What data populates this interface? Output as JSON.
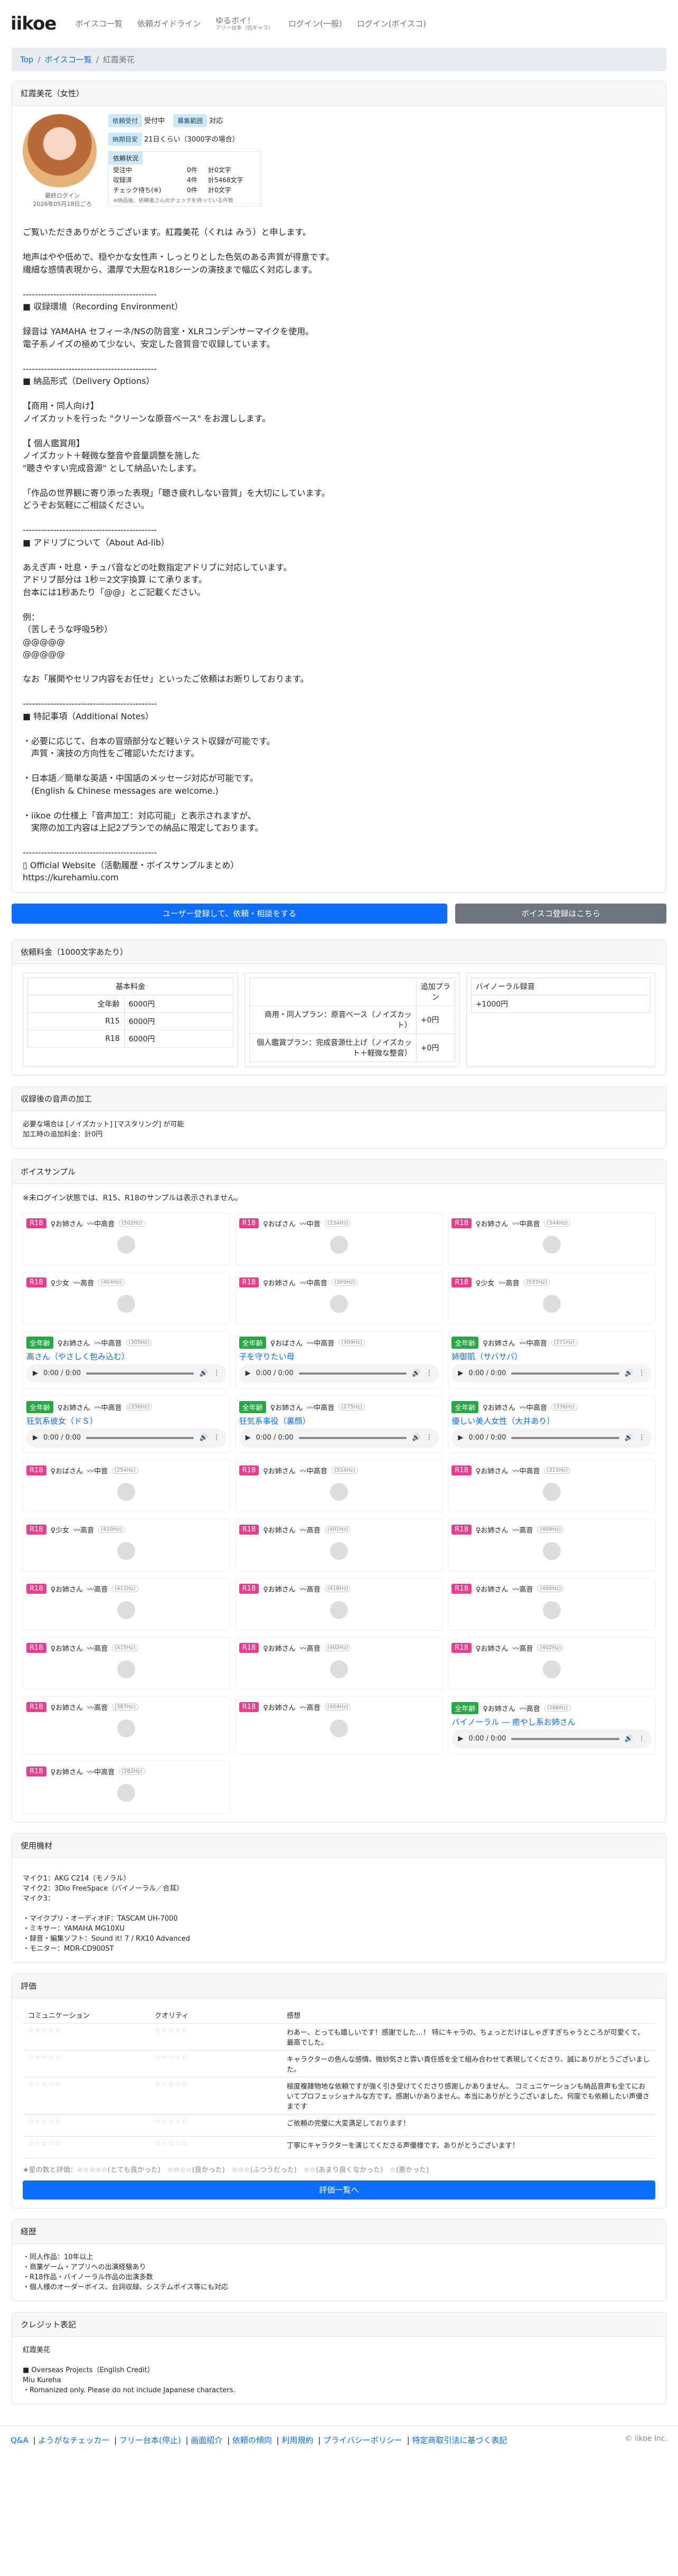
{
  "nav": {
    "brand": "iikoe",
    "links": [
      "ボイスコ一覧",
      "依頼ガイドライン",
      "ゆるボイ！",
      "ログイン(一般)",
      "ログイン(ボイスコ)"
    ],
    "yurusub": "フリー台本（低ギャラ）"
  },
  "breadcrumb": {
    "top": "Top",
    "list": "ボイスコ一覧",
    "current": "紅霞美花"
  },
  "profile": {
    "header": "紅霞美花（女性）",
    "last_login_label": "最終ログイン",
    "last_login": "2026年05月18日ごろ",
    "badges": [
      {
        "label": "依頼受付",
        "value": "受付中"
      },
      {
        "label": "募集範囲",
        "value": "対応"
      },
      {
        "label": "納期目安",
        "value": "21日くらい（3000字の場合）"
      }
    ],
    "counts_title": "依頼状況",
    "counts": [
      {
        "k": "受注中",
        "n": "0件",
        "v": "計0文字"
      },
      {
        "k": "収録済",
        "n": "4件",
        "v": "計5468文字"
      },
      {
        "k": "チェック待ち(※)",
        "n": "0件",
        "v": "計0文字"
      }
    ],
    "counts_note": "※納品後、依頼者さんのチェックを待っている件数",
    "description": "ご覧いただきありがとうございます。紅霞美花（くれは みう）と申します。\n\n地声はやや低めで、穏やかな女性声・しっとりとした色気のある声質が得意です。\n繊細な感情表現から、濃厚で大胆なR18シーンの演技まで幅広く対応します。\n\n--------------------------------------------\n■ 収録環境（Recording Environment）\n\n録音は YAMAHA セフィーネ/NSの防音室・XLRコンデンサーマイクを使用。\n電子系ノイズの極めて少ない、安定した音質音で収録しています。\n\n--------------------------------------------\n■ 納品形式（Delivery Options）\n\n【商用・同人向け】\nノイズカットを行った \"クリーンな原音ベース\" をお渡しします。\n\n【 個人鑑賞用】\nノイズカット＋軽微な整音や音量調整を施した\n\"聴きやすい完成音源\" として納品いたします。\n\n「作品の世界観に寄り添った表現」「聴き疲れしない音質」を大切にしています。\nどうぞお気軽にご相談ください。\n\n--------------------------------------------\n■ アドリブについて（About Ad-lib）\n\nあえぎ声・吐息・チュパ音などの吐数指定アドリブに対応しています。\nアドリブ部分は 1秒＝2文字換算 にて承ります。\n台本には1秒あたり「@@」とご記載ください。\n\n例：\n（苦しそうな呼吸5秒）\n@@@@@\n@@@@@\n\nなお「展開やセリフ内容をお任せ」といったご依頼はお断りしております。\n\n--------------------------------------------\n■ 特記事項（Additional Notes）\n\n・必要に応じて、台本の冒頭部分など軽いテスト収録が可能です。\n　声質・演技の方向性をご確認いただけます。\n\n・日本語／簡単な英語・中国語のメッセージ対応が可能です。\n　(English & Chinese messages are welcome.)\n\n・iikoe の仕様上「音声加工：対応可能」と表示されますが、\n　実際の加工内容は上記2プランでの納品に限定しております。\n\n--------------------------------------------\n▯ Official Website（活動履歴・ボイスサンプルまとめ）\nhttps://kurehamiu.com"
  },
  "buttons": {
    "request": "ユーザー登録して、依頼・相談をする",
    "register": "ボイスコ登録はこちら"
  },
  "pricing": {
    "header": "依頼料金（1000文字あたり）",
    "base_title": "基本料金",
    "base": [
      {
        "k": "全年齢",
        "v": "6000円"
      },
      {
        "k": "R15",
        "v": "6000円"
      },
      {
        "k": "R18",
        "v": "6000円"
      }
    ],
    "plan_title": "追加プラン",
    "plans": [
      {
        "k": "商用・同人プラン：原音ベース（ノイズカット）",
        "v": "+0円"
      },
      {
        "k": "個人鑑賞プラン：完成音源仕上げ（ノイズカット＋軽微な整音）",
        "v": "+0円"
      }
    ],
    "binaural_title": "バイノーラル録音",
    "binaural": "+1000円"
  },
  "processing": {
    "header": "収録後の音声の加工",
    "lines": [
      "必要な場合は [ノイズカット] [マスタリング] が可能",
      "加工時の追加料金：計0円"
    ]
  },
  "samples": {
    "header": "ボイスサンプル",
    "note": "※未ログイン状態では、R15、R18のサンプルは表示されません。",
    "items": [
      {
        "rating": "R18",
        "age": "お姉さん",
        "pitch": "中高音",
        "hz": "(502Hz)"
      },
      {
        "rating": "R18",
        "age": "おばさん",
        "pitch": "中音",
        "hz": "(234Hz)"
      },
      {
        "rating": "R18",
        "age": "お姉さん",
        "pitch": "中高音",
        "hz": "(344Hz)"
      },
      {
        "rating": "R18",
        "age": "少女",
        "pitch": "高音",
        "hz": "(404Hz)"
      },
      {
        "rating": "R18",
        "age": "お姉さん",
        "pitch": "中高音",
        "hz": "(309Hz)"
      },
      {
        "rating": "R18",
        "age": "少女",
        "pitch": "高音",
        "hz": "(537Hz)"
      },
      {
        "rating": "全年齢",
        "age": "お姉さん",
        "pitch": "中高音",
        "hz": "(305Hz)",
        "title": "高さん（やさしく包み込む）"
      },
      {
        "rating": "全年齢",
        "age": "おばさん",
        "pitch": "中高音",
        "hz": "(309Hz)",
        "title": "子を守りたい母"
      },
      {
        "rating": "全年齢",
        "age": "お姉さん",
        "pitch": "中高音",
        "hz": "(271Hz)",
        "title": "姉御肌（サバサバ）"
      },
      {
        "rating": "全年齢",
        "age": "お姉さん",
        "pitch": "中高音",
        "hz": "(336Hz)",
        "title": "狂気系彼女（ドＳ）"
      },
      {
        "rating": "全年齢",
        "age": "お姉さん",
        "pitch": "中高音",
        "hz": "(275Hz)",
        "title": "狂気系事役（裏顔）"
      },
      {
        "rating": "全年齢",
        "age": "お姉さん",
        "pitch": "中高音",
        "hz": "(336Hz)",
        "title": "優しい美人女性（大井あり）"
      },
      {
        "rating": "R18",
        "age": "おばさん",
        "pitch": "中音",
        "hz": "(254Hz)"
      },
      {
        "rating": "R18",
        "age": "お姉さん",
        "pitch": "中高音",
        "hz": "(334Hz)"
      },
      {
        "rating": "R18",
        "age": "お姉さん",
        "pitch": "中高音",
        "hz": "(315Hz)"
      },
      {
        "rating": "R18",
        "age": "少女",
        "pitch": "高音",
        "hz": "(410Hz)"
      },
      {
        "rating": "R18",
        "age": "お姉さん",
        "pitch": "高音",
        "hz": "(401Hz)"
      },
      {
        "rating": "R18",
        "age": "お姉さん",
        "pitch": "高音",
        "hz": "(409Hz)"
      },
      {
        "rating": "R18",
        "age": "お姉さん",
        "pitch": "高音",
        "hz": "(411Hz)"
      },
      {
        "rating": "R18",
        "age": "お姉さん",
        "pitch": "高音",
        "hz": "(418Hz)"
      },
      {
        "rating": "R18",
        "age": "お姉さん",
        "pitch": "高音",
        "hz": "(400Hz)"
      },
      {
        "rating": "R18",
        "age": "お姉さん",
        "pitch": "高音",
        "hz": "(415Hz)"
      },
      {
        "rating": "R18",
        "age": "お姉さん",
        "pitch": "高音",
        "hz": "(402Hz)"
      },
      {
        "rating": "R18",
        "age": "お姉さん",
        "pitch": "高音",
        "hz": "(402Hz)"
      },
      {
        "rating": "R18",
        "age": "お姉さん",
        "pitch": "高音",
        "hz": "(387Hz)"
      },
      {
        "rating": "R18",
        "age": "お姉さん",
        "pitch": "高音",
        "hz": "(404Hz)"
      },
      {
        "rating": "全年齢",
        "age": "お姉さん",
        "pitch": "高音",
        "hz": "(266Hz)",
        "title": "バイノーラル ― 癒やし系お姉さん"
      },
      {
        "rating": "R18",
        "age": "お姉さん",
        "pitch": "中高音",
        "hz": "(282Hz)"
      }
    ],
    "time": "0:00 / 0:00"
  },
  "equipment": {
    "header": "使用機材",
    "text": "マイク1：AKG C214（モノラル）\nマイク2：3Dio FreeSpace（バイノーラル／合耳）\nマイク3：\n\n・マイクプリ・オーディオIF：TASCAM UH-7000\n・ミキサー：YAMAHA MG10XU\n・録音・編集ソフト：Sound it! 7 / RX10 Advanced\n・モニター：MDR-CD900ST"
  },
  "reviews": {
    "header": "評価",
    "cols": [
      "コミュニケーション",
      "クオリティ",
      "感想"
    ],
    "rows": [
      {
        "c": "☆☆☆☆☆",
        "q": "☆☆☆☆☆",
        "t": "わあー、とっても嬉しいです！感謝でした…！ 特にキャラの、ちょっとだけはしゃぎすぎちゃうところが可愛くて、最高でした。"
      },
      {
        "c": "☆☆☆☆☆",
        "q": "☆☆☆☆☆",
        "t": "キャラクターの色んな感情、微妙気さと雰い責任感を全て組み合わせて表現してくださり、誠にありがとうございました。"
      },
      {
        "c": "☆☆☆☆☆",
        "q": "☆☆☆☆☆",
        "t": "極度複雑物地な依頼ですが強く引き受けてくださり感謝しかありません。 コミュニケーションも納品音声も全てにおいてプロフェッショナルな方です。感謝いかありません。本当にありがとうございました。何度でも依頼したい声優さまです"
      },
      {
        "c": "☆☆☆☆☆",
        "q": "☆☆☆☆☆",
        "t": "ご依頼の完璧に大変満足しております！"
      },
      {
        "c": "☆☆☆☆☆",
        "q": "☆☆☆☆☆",
        "t": "丁寧にキャラクターを演じてくださる声優様です。ありがとうございます！"
      }
    ],
    "legend": "★星の数と評価：☆☆☆☆☆(とても良かった)　☆☆☆☆(良かった)　☆☆☆(ふつうだった)　☆☆(あまり良くなかった)　☆(悪かった)",
    "all_button": "評価一覧へ"
  },
  "career": {
    "header": "経歴",
    "text": "・同人作品：10年以上\n・商業ゲーム・アプリへの出演経験あり\n・R18作品・バイノーラル作品の出演多数\n・個人様のオーダーボイス、台詞収録、システムボイス等にも対応"
  },
  "credit": {
    "header": "クレジット表記",
    "text": "紅霞美花\n\n■ Overseas Projects（English Credit）\nMiu Kureha\n・Romanized only. Please do not include Japanese characters."
  },
  "footer": {
    "links": [
      "Q&A",
      "ようがなチェッカー",
      "フリー台本(停止)",
      "画面紹介",
      "依頼の傾向",
      "利用規約",
      "プライバシーポリシー",
      "特定商取引法に基づく表記"
    ],
    "copy": "© iikoe Inc."
  }
}
